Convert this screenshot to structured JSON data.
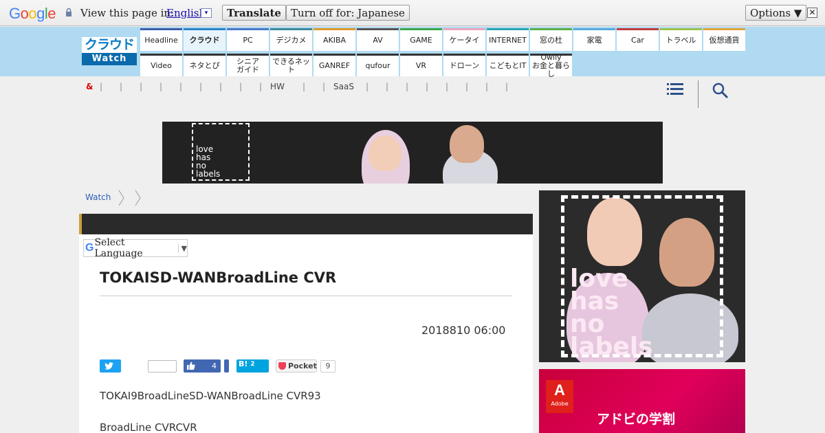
{
  "translate_bar": {
    "logo_letters": [
      "G",
      "o",
      "o",
      "g",
      "l",
      "e"
    ],
    "logo_colors": [
      "#4285f4",
      "#ea4335",
      "#fbbc05",
      "#4285f4",
      "#34a853",
      "#ea4335"
    ],
    "view_text": "View this page in:",
    "language": "English",
    "language_arrow": "▾",
    "translate_label": "Translate",
    "turn_off_label": "Turn off for: Japanese",
    "options_label": "Options ▼",
    "close_label": "✕"
  },
  "site": {
    "logo_top": "クラウド",
    "logo_bottom": "Watch",
    "accent": "#0a6aab",
    "header_bg": "#b0daf1"
  },
  "nav_row1": [
    {
      "label": "Headline",
      "color": "#3b5ea8"
    },
    {
      "label": "クラウド",
      "color": "#2a84c9",
      "active": true
    },
    {
      "label": "PC",
      "color": "#4a78c8"
    },
    {
      "label": "デジカメ",
      "color": "#3c8a9a"
    },
    {
      "label": "AKIBA",
      "color": "#e09a2a"
    },
    {
      "label": "AV",
      "color": "#555555"
    },
    {
      "label": "GAME",
      "color": "#3aa84a"
    },
    {
      "label": "ケータイ",
      "color": "#e8a7c0"
    },
    {
      "label": "INTERNET",
      "color": "#2ca6b0"
    },
    {
      "label": "窓の杜",
      "color": "#5cae46"
    },
    {
      "label": "家電",
      "color": "#55aadd"
    },
    {
      "label": "Car",
      "color": "#c0393f"
    },
    {
      "label": "トラベル",
      "color": "#9fc04a"
    },
    {
      "label": "仮想通貨",
      "color": "#e0a43a"
    }
  ],
  "nav_row2": [
    {
      "label": "Video"
    },
    {
      "label": "ネタとぴ"
    },
    {
      "label": "シニア\nガイド"
    },
    {
      "label": "できるネット"
    },
    {
      "label": "GANREF"
    },
    {
      "label": "qufour"
    },
    {
      "label": "VR"
    },
    {
      "label": "ドローン"
    },
    {
      "label": "こどもとIT"
    },
    {
      "label": "Owlly\nお金と暮らし"
    }
  ],
  "subnav": {
    "amp": "&",
    "labels": [
      {
        "text": "HW",
        "after_sep": 9
      },
      {
        "text": "SaaS",
        "after_sep": 11
      }
    ],
    "separator": "|",
    "separator_count": 19
  },
  "banner_ad": {
    "slogan_lines": [
      "love",
      "has",
      "no",
      "labels"
    ]
  },
  "breadcrumb": {
    "home": "Watch"
  },
  "article": {
    "select_language": "Select Language",
    "select_arrow": "▼",
    "g_letter": "G",
    "title": "TOKAISD-WANBroadLine CVR",
    "date": "2018810 06:00",
    "like_count": "4",
    "hatena_label": "B!",
    "hatena_count": "2",
    "pocket_label": "Pocket",
    "pocket_count": "9",
    "paragraphs": [
      "TOKAI9BroadLineSD-WANBroadLine CVR93",
      "BroadLine CVRCVR"
    ]
  },
  "side_ads": {
    "ad1_slogan_lines": [
      "love",
      "has",
      "no",
      "labels"
    ],
    "ad2_brand": "Adobe",
    "ad2_brand_letter": "A",
    "ad2_text": "アドビの学割"
  }
}
